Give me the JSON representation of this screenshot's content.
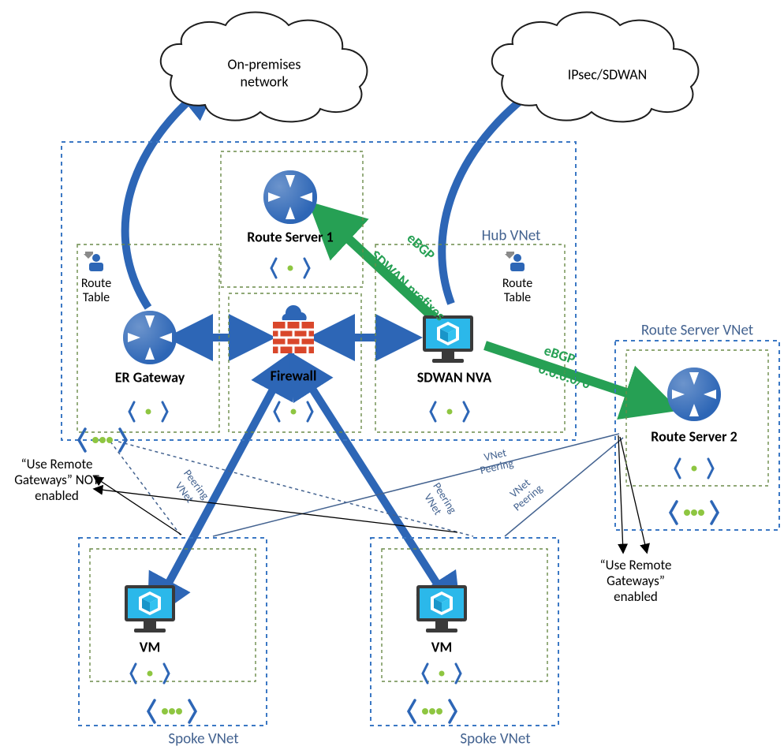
{
  "clouds": {
    "onprem": "On-premises\nnetwork",
    "ipsec": "IPsec/SDWAN"
  },
  "nodes": {
    "routeServer1": "Route Server 1",
    "erGateway": "ER Gateway",
    "firewall": "Firewall",
    "sdwanNva": "SDWAN NVA",
    "routeServer2": "Route Server 2",
    "vm": "VM",
    "routeTable": "Route Table"
  },
  "vnets": {
    "hub": "Hub VNet",
    "routeServer": "Route Server VNet",
    "spoke": "Spoke VNet"
  },
  "links": {
    "vnetPeering": "VNet Peering",
    "ebgp": "eBGP",
    "sdwanPrefixes": "SDWAN prefixes",
    "default": "0.0.0.0/0"
  },
  "annotations": {
    "useRemoteNot": "“Use Remote Gateways” NOT enabled",
    "useRemoteYes": "“Use Remote Gateways” enabled"
  }
}
